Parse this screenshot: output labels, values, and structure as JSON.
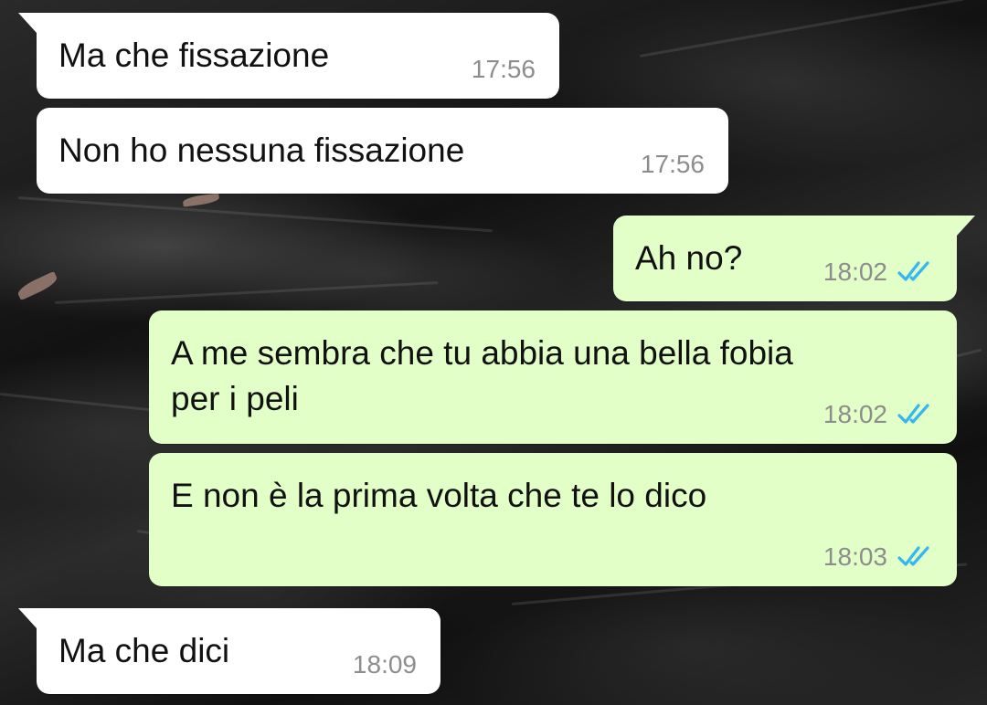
{
  "theme": {
    "incoming_color": "#ffffff",
    "outgoing_color": "#e2ffc7",
    "time_color": "#8d8d8d",
    "read_tick_color": "#34b7f1"
  },
  "messages": [
    {
      "direction": "incoming",
      "text": "Ma che fissazione",
      "time": "17:56"
    },
    {
      "direction": "incoming",
      "text": "Non ho nessuna fissazione",
      "time": "17:56"
    },
    {
      "direction": "outgoing",
      "text": "Ah no?",
      "time": "18:02",
      "status": "double-check-read"
    },
    {
      "direction": "outgoing",
      "text": "A me sembra che tu abbia una bella fobia\nper i peli",
      "time": "18:02",
      "status": "double-check-read"
    },
    {
      "direction": "outgoing",
      "text": "E non è la prima volta che te lo dico",
      "time": "18:03",
      "status": "double-check-read"
    },
    {
      "direction": "incoming",
      "text": "Ma che dici",
      "time": "18:09"
    }
  ]
}
